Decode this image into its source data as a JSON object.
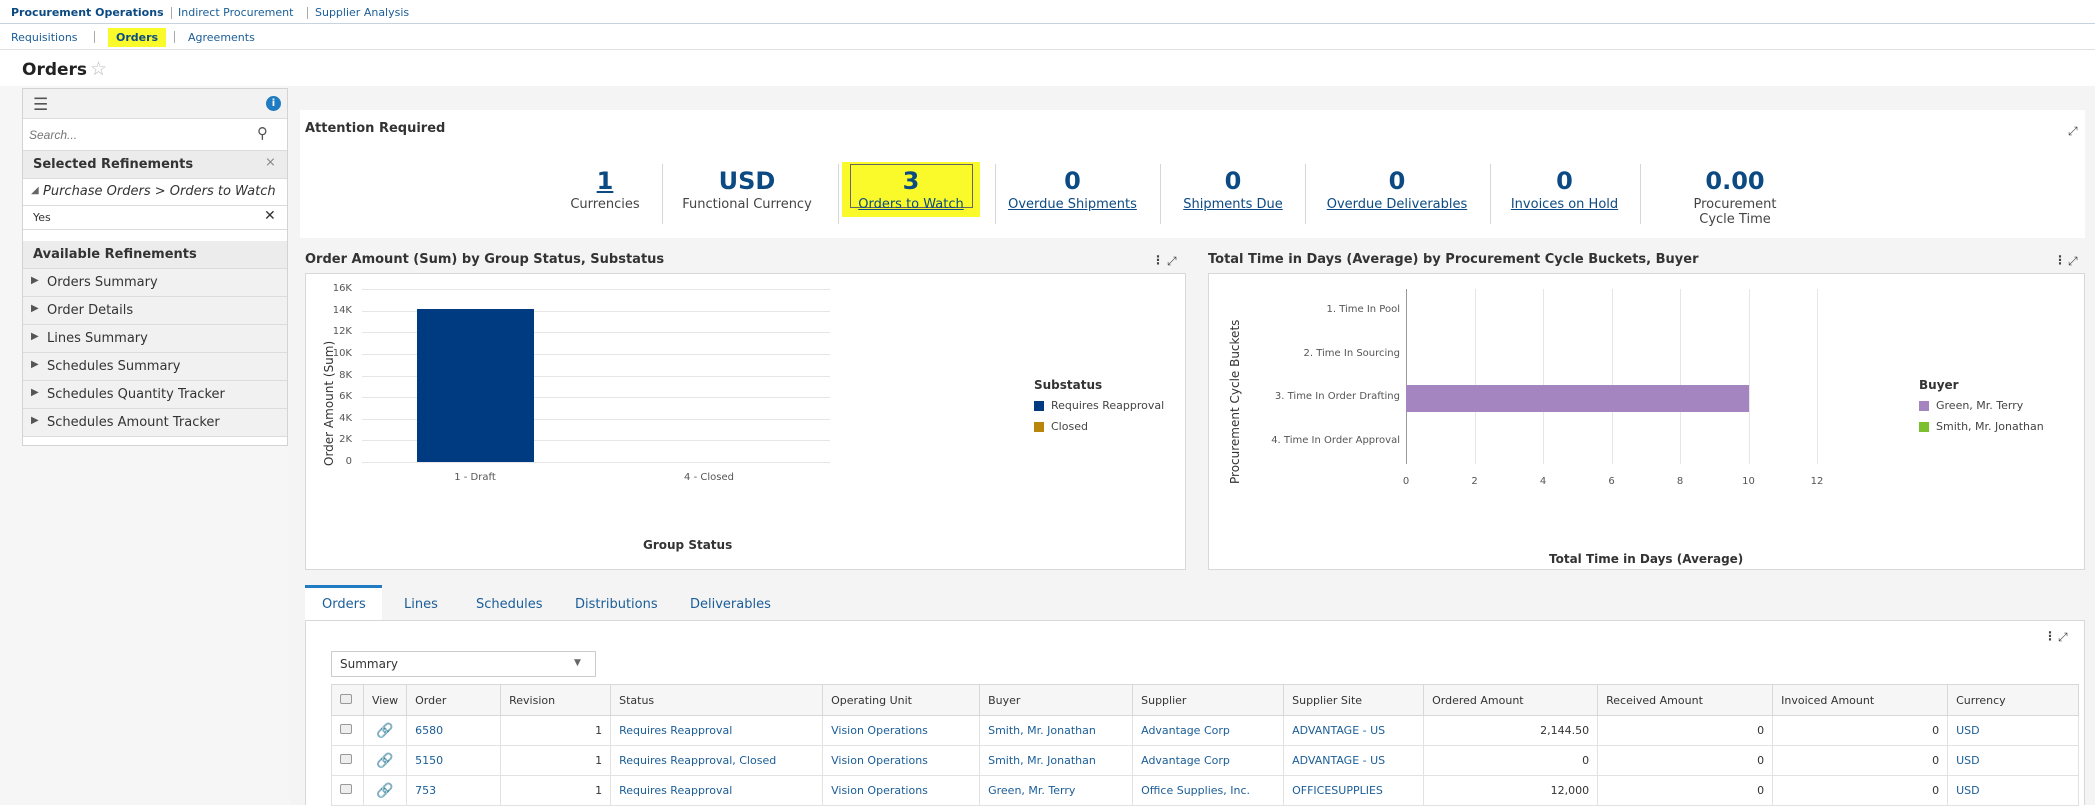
{
  "top_tabs": [
    "Procurement Operations",
    "Indirect Procurement",
    "Supplier Analysis"
  ],
  "sub_tabs": [
    "Requisitions",
    "Orders",
    "Agreements"
  ],
  "page_title": "Orders",
  "left": {
    "search_placeholder": "Search...",
    "selected_refinements": "Selected Refinements",
    "refinement_path": "Purchase Orders > Orders to Watch",
    "refinement_value": "Yes",
    "available_refinements": "Available Refinements",
    "refinements": [
      "Orders Summary",
      "Order Details",
      "Lines Summary",
      "Schedules Summary",
      "Schedules Quantity Tracker",
      "Schedules Amount Tracker"
    ]
  },
  "attention": {
    "title": "Attention Required",
    "kpis": [
      {
        "value": "1",
        "label": "Currencies"
      },
      {
        "value": "USD",
        "label": "Functional Currency"
      },
      {
        "value": "3",
        "label": "Orders to Watch"
      },
      {
        "value": "0",
        "label": "Overdue Shipments"
      },
      {
        "value": "0",
        "label": "Shipments Due"
      },
      {
        "value": "0",
        "label": "Overdue Deliverables"
      },
      {
        "value": "0",
        "label": "Invoices on Hold"
      },
      {
        "value": "0.00",
        "label": "Procurement Cycle Time"
      }
    ]
  },
  "chart1": {
    "title": "Order Amount (Sum) by Group Status, Substatus",
    "legend_title": "Substatus",
    "chart_data": {
      "type": "bar",
      "categories": [
        "1 - Draft",
        "4 - Closed"
      ],
      "series": [
        {
          "name": "Requires Reapproval",
          "values": [
            14144.5,
            0
          ]
        },
        {
          "name": "Closed",
          "values": [
            0,
            0
          ]
        }
      ],
      "xlabel": "Group Status",
      "ylabel": "Order Amount (Sum)",
      "ylim": [
        0,
        16000
      ],
      "yticks": [
        "16K",
        "14K",
        "12K",
        "10K",
        "8K",
        "6K",
        "4K",
        "2K",
        "0"
      ],
      "colors": [
        "#003a80",
        "#b8860b"
      ]
    }
  },
  "chart2": {
    "title": "Total Time in Days (Average) by Procurement Cycle Buckets, Buyer",
    "legend_title": "Buyer",
    "chart_data": {
      "type": "bar",
      "orientation": "horizontal",
      "categories": [
        "1. Time In Pool",
        "2. Time In Sourcing",
        "3. Time In Order Drafting",
        "4. Time In Order Approval"
      ],
      "series": [
        {
          "name": "Green, Mr. Terry",
          "values": [
            0,
            0,
            10,
            0
          ]
        },
        {
          "name": "Smith, Mr. Jonathan",
          "values": [
            0,
            0,
            0,
            0
          ]
        }
      ],
      "xlabel": "Total Time in Days (Average)",
      "ylabel": "Procurement Cycle Buckets",
      "xlim": [
        0,
        12
      ],
      "xticks": [
        "0",
        "2",
        "4",
        "6",
        "8",
        "10",
        "12"
      ],
      "colors": [
        "#a585c0",
        "#7cbf2f"
      ]
    }
  },
  "bottom_tabs": [
    "Orders",
    "Lines",
    "Schedules",
    "Distributions",
    "Deliverables"
  ],
  "summary_select": "Summary",
  "table": {
    "columns": [
      "",
      "View",
      "Order",
      "Revision",
      "Status",
      "Operating Unit",
      "Buyer",
      "Supplier",
      "Supplier Site",
      "Ordered Amount",
      "Received Amount",
      "Invoiced Amount",
      "Currency"
    ],
    "rows": [
      [
        "6580",
        "1",
        "Requires Reapproval",
        "Vision Operations",
        "Smith, Mr. Jonathan",
        "Advantage Corp",
        "ADVANTAGE - US",
        "2,144.50",
        "0",
        "0",
        "USD"
      ],
      [
        "5150",
        "1",
        "Requires Reapproval, Closed",
        "Vision Operations",
        "Smith, Mr. Jonathan",
        "Advantage Corp",
        "ADVANTAGE - US",
        "0",
        "0",
        "0",
        "USD"
      ],
      [
        "753",
        "1",
        "Requires Reapproval",
        "Vision Operations",
        "Green, Mr. Terry",
        "Office Supplies, Inc.",
        "OFFICESUPPLIES",
        "12,000",
        "0",
        "0",
        "USD"
      ]
    ]
  }
}
